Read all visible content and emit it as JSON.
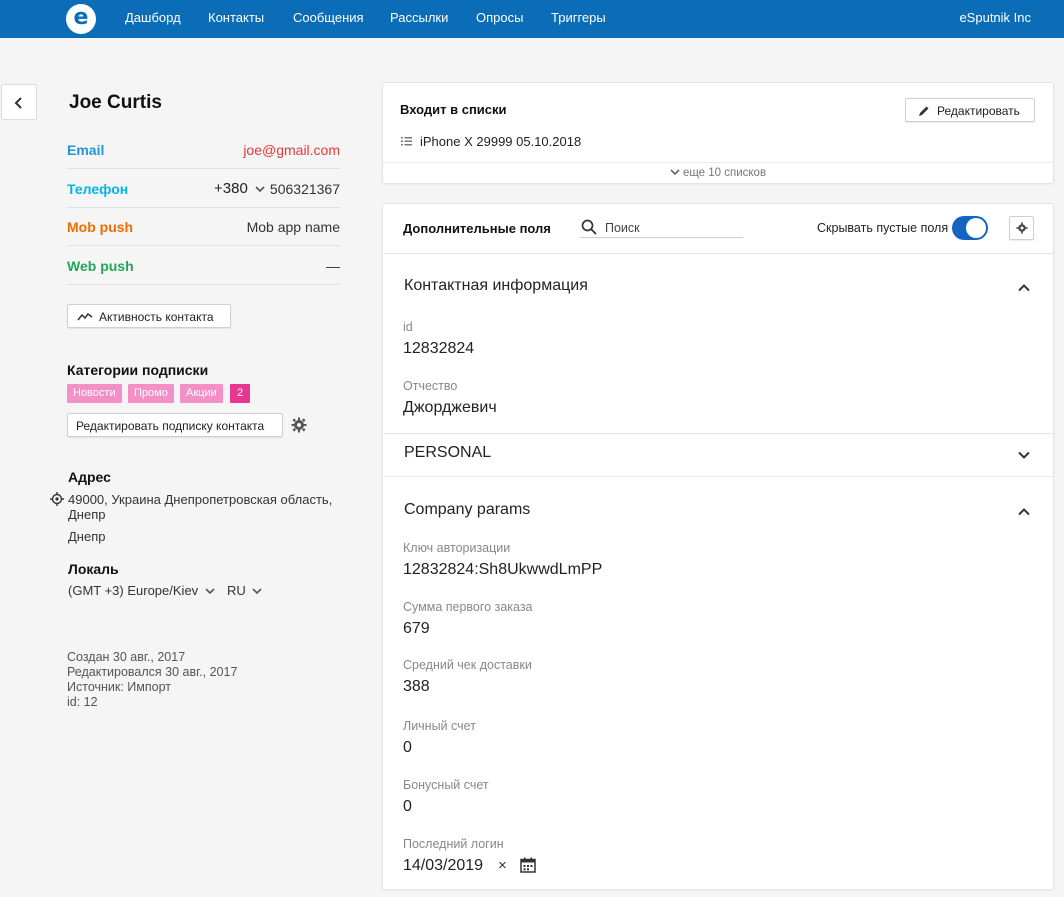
{
  "app": {
    "logo_letter": "e",
    "nav": [
      "Дашборд",
      "Контакты",
      "Сообщения",
      "Рассылки",
      "Опросы",
      "Триггеры"
    ],
    "company": "eSputnik Inc",
    "colors": {
      "header": "#0b6db7",
      "email": "#2196d3",
      "phone": "#00b6e6",
      "mob": "#ef6c00",
      "web": "#21a65a",
      "error": "#e53935",
      "toggle": "#1565c0",
      "tag": "#f48fc8",
      "tag_count": "#e8378f"
    }
  },
  "contact": {
    "name": "Joe Curtis",
    "email_label": "Email",
    "email_value": "joe@gmail.com",
    "phone_label": "Телефон",
    "phone_code": "+380",
    "phone_number": "506321367",
    "mob_label": "Mob push",
    "mob_value": "Mob app name",
    "web_label": "Web push",
    "web_value": "—",
    "activity_button": "Активность контакта"
  },
  "subscription": {
    "title": "Категории подписки",
    "tags": [
      "Новости",
      "Промо",
      "Акции"
    ],
    "extra_count": "2",
    "edit_button": "Редактировать подписку контакта"
  },
  "address": {
    "title": "Адрес",
    "line1": "49000, Украина Днепропетровская область,",
    "line2": "Днепр",
    "city": "Днепр"
  },
  "locale": {
    "title": "Локаль",
    "timezone": "(GMT +3) Europe/Kiev",
    "language": "RU"
  },
  "meta": {
    "created": "Создан 30 авг., 2017",
    "edited": "Редактировался 30 авг., 2017",
    "source": "Источник: Импорт",
    "id": "id: 12"
  },
  "lists": {
    "title": "Входит в списки",
    "edit_button": "Редактировать",
    "item": "iPhone X 29999 05.10.2018",
    "more": "еще 10 списков"
  },
  "fields": {
    "title": "Дополнительные поля",
    "search_placeholder": "Поиск",
    "hide_empty_label": "Скрывать пустые поля",
    "hide_empty_on": true,
    "groups": {
      "contact_info": {
        "title": "Контактная информация",
        "items": [
          {
            "label": "id",
            "value": "12832824"
          },
          {
            "label": "Отчество",
            "value": "Джорджевич"
          }
        ]
      },
      "personal": {
        "title": "PERSONAL"
      },
      "company": {
        "title": "Company params",
        "items": [
          {
            "label": "Ключ авторизации",
            "value": "12832824:Sh8UkwwdLmPP"
          },
          {
            "label": "Сумма первого заказа",
            "value": "679"
          },
          {
            "label": "Средний чек доставки",
            "value": "388"
          },
          {
            "label": "Личный счет",
            "value": "0"
          },
          {
            "label": "Бонусный счет",
            "value": "0"
          },
          {
            "label": "Последний логин",
            "value": "14/03/2019"
          }
        ]
      }
    },
    "clear_glyph": "×"
  }
}
